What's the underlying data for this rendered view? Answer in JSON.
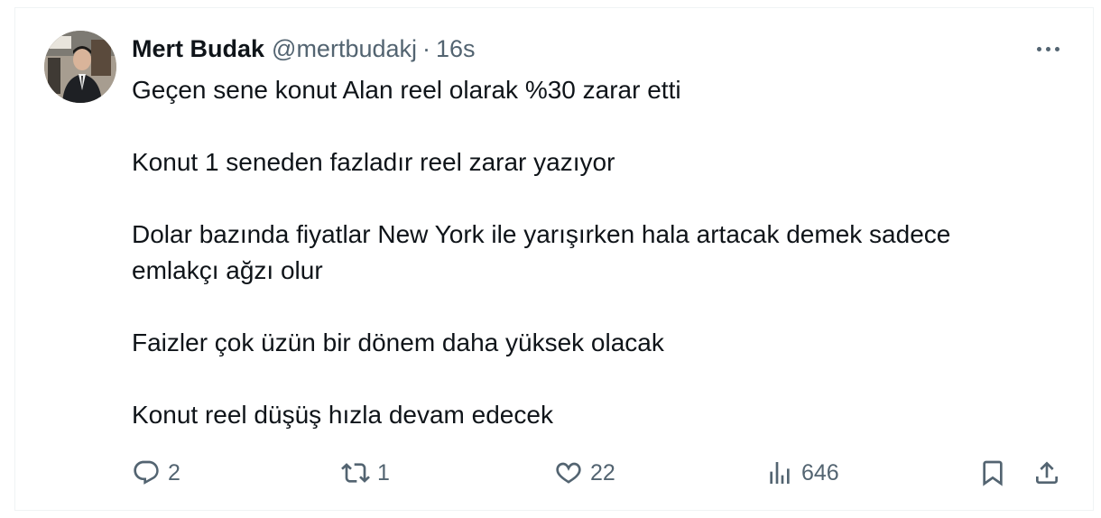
{
  "tweet": {
    "author_name": "Mert Budak",
    "handle": "@mertbudakj",
    "separator": "·",
    "time": "16s",
    "paragraphs": [
      "Geçen sene konut Alan reel olarak %30 zarar etti",
      "Konut 1 seneden fazladır reel zarar yazıyor",
      "Dolar bazında fiyatlar New York ile yarışırken hala artacak demek sadece emlakçı ağzı olur",
      "Faizler çok üzün bir dönem daha yüksek olacak",
      "Konut reel düşüş hızla devam edecek"
    ]
  },
  "actions": {
    "replies": "2",
    "reposts": "1",
    "likes": "22",
    "views": "646"
  },
  "icons": {
    "more": "more-horizontal-icon",
    "reply": "reply-bubble-icon",
    "repost": "repost-arrows-icon",
    "like": "heart-icon",
    "views": "bar-chart-icon",
    "bookmark": "bookmark-icon",
    "share": "share-upload-icon"
  },
  "colors": {
    "text": "#0f1419",
    "secondary": "#536471",
    "border": "#eff3f4"
  }
}
